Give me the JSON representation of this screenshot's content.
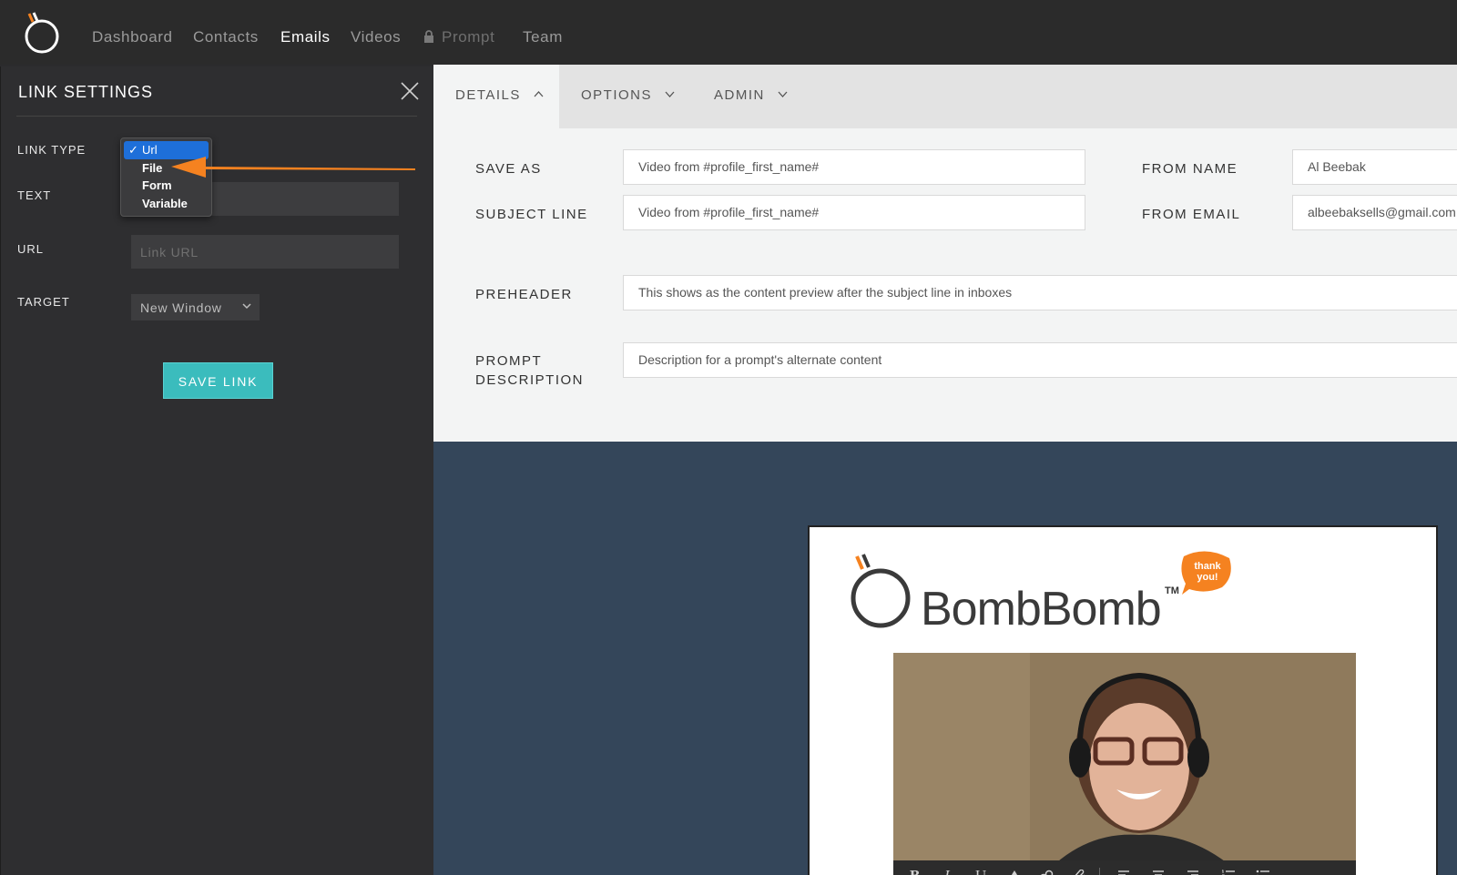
{
  "nav": {
    "items": [
      "Dashboard",
      "Contacts",
      "Emails",
      "Videos",
      "Prompt",
      "Team"
    ],
    "active": "Emails",
    "disabled": "Prompt"
  },
  "link_settings": {
    "title": "LINK SETTINGS",
    "link_type_label": "LINK TYPE",
    "text_label": "TEXT",
    "url_label": "URL",
    "url_placeholder": "Link URL",
    "target_label": "TARGET",
    "target_value": "New Window",
    "save_label": "SAVE LINK",
    "dropdown": {
      "options": [
        "Url",
        "File",
        "Form",
        "Variable"
      ],
      "selected": "Url",
      "check": "✓"
    }
  },
  "tabs": {
    "details": "DETAILS",
    "options": "OPTIONS",
    "admin": "ADMIN"
  },
  "form": {
    "save_as_label": "SAVE AS",
    "save_as_value": "Video from #profile_first_name#",
    "subject_label": "SUBJECT LINE",
    "subject_value": "Video from #profile_first_name#",
    "from_name_label": "FROM NAME",
    "from_name_value": "Al Beebak",
    "from_email_label": "FROM EMAIL",
    "from_email_value": "albeebaksells@gmail.com",
    "preheader_label": "PREHEADER",
    "preheader_value": "This shows as the content preview after the subject line in inboxes",
    "prompt_desc_label_1": "PROMPT",
    "prompt_desc_label_2": "DESCRIPTION",
    "prompt_desc_value": "Description for a prompt's alternate content"
  },
  "preview": {
    "brand": "BombBomb",
    "tm": "TM",
    "badge_line1": "thank",
    "badge_line2": "you!",
    "toolbar": [
      "B",
      "I",
      "U"
    ]
  },
  "colors": {
    "accent": "#3bbcbd",
    "orange": "#f58220",
    "select_blue": "#1e6fd9",
    "preview_bg": "#34465a"
  }
}
